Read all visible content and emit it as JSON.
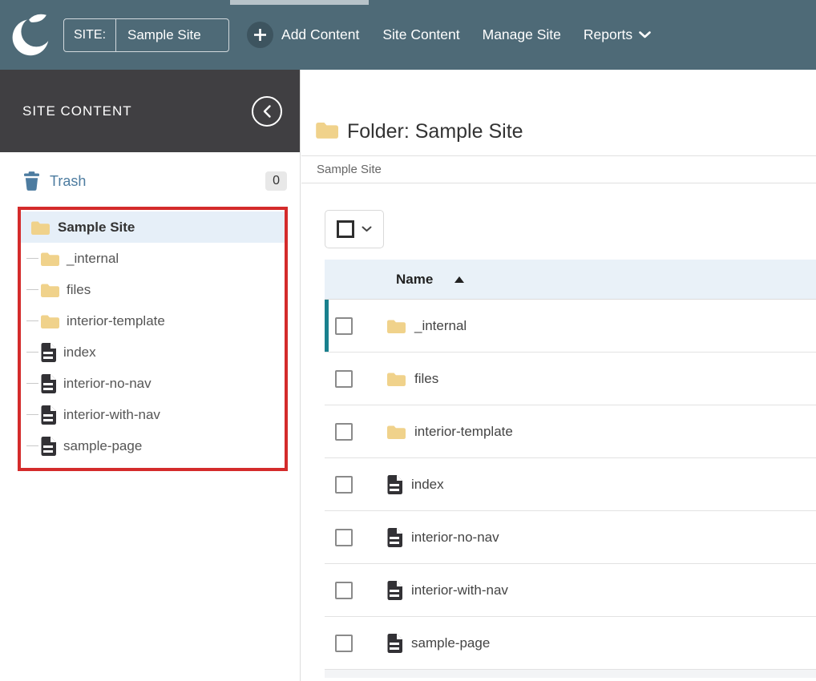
{
  "colors": {
    "topbar_bg": "#4e6a77",
    "active_tab_indicator": "#b7c3c9",
    "add_circle_bg": "#3d545f",
    "sidebar_header_bg": "#403f42",
    "trash_blue": "#4d7ca0",
    "folder_yellow": "#f0d28b",
    "page_icon_dark": "#323135",
    "selected_tree_row_bg": "#e6eff8",
    "table_header_bg": "#e9f1f8",
    "row_accent_teal": "#19808d",
    "annotation_red": "#d42b2b"
  },
  "header": {
    "site_label": "SITE:",
    "site_value": "Sample Site",
    "add_content_label": "Add Content",
    "nav_items": [
      {
        "label": "Site Content"
      },
      {
        "label": "Manage Site"
      },
      {
        "label": "Reports",
        "has_dropdown": true
      }
    ]
  },
  "sidebar": {
    "panel_title": "SITE CONTENT",
    "trash_label": "Trash",
    "trash_count": "0",
    "tree_root": {
      "label": "Sample Site",
      "type": "folder",
      "selected": true
    },
    "tree_children": [
      {
        "label": "_internal",
        "type": "folder"
      },
      {
        "label": "files",
        "type": "folder"
      },
      {
        "label": "interior-template",
        "type": "folder"
      },
      {
        "label": "index",
        "type": "page"
      },
      {
        "label": "interior-no-nav",
        "type": "page"
      },
      {
        "label": "interior-with-nav",
        "type": "page"
      },
      {
        "label": "sample-page",
        "type": "page"
      }
    ]
  },
  "main": {
    "title": "Folder: Sample Site",
    "breadcrumb": "Sample Site",
    "table": {
      "name_column_label": "Name",
      "sort_direction": "ascending",
      "rows": [
        {
          "name": "_internal",
          "type": "folder",
          "accented": true
        },
        {
          "name": "files",
          "type": "folder",
          "accented": false
        },
        {
          "name": "interior-template",
          "type": "folder",
          "accented": false
        },
        {
          "name": "index",
          "type": "page",
          "accented": false
        },
        {
          "name": "interior-no-nav",
          "type": "page",
          "accented": false
        },
        {
          "name": "interior-with-nav",
          "type": "page",
          "accented": false
        },
        {
          "name": "sample-page",
          "type": "page",
          "accented": false
        }
      ]
    }
  }
}
